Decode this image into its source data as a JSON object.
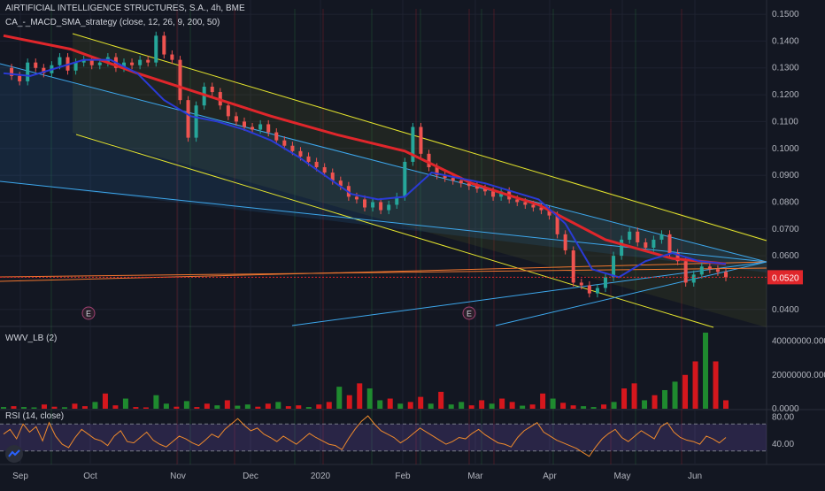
{
  "header": {
    "title": "AIRTIFICIAL INTELLIGENCE STRUCTURES, S.A., 4h, BME",
    "strategy": "CA_-_MACD_SMA_strategy (close, 12, 26, 9, 200, 50)",
    "volume_indicator": "WWV_LB (2)",
    "rsi_indicator": "RSI (14, close)"
  },
  "colors": {
    "background": "#131722",
    "sma200": "#e0262b",
    "sma50_up": "#2a3bd6",
    "sma50_down": "#d6413d",
    "trend_lines": "#e5e52d",
    "fan_lines": "#3da7ec",
    "horizontal_line": "#f0762f",
    "volume_up": "#1f8a2f",
    "volume_down": "#d5171d",
    "rsi_line": "#ef8a2c",
    "rsi_band": "#7b5dc7",
    "price_label": "#e0262b"
  },
  "chart_data": [
    {
      "type": "line",
      "panel": "price",
      "price_axis_ticks": [
        "0.1500",
        "0.1400",
        "0.1300",
        "0.1200",
        "0.1100",
        "0.1000",
        "0.0900",
        "0.0800",
        "0.0700",
        "0.0600",
        "0.0400"
      ],
      "time_axis_ticks": [
        "Sep",
        "Oct",
        "Nov",
        "Dec",
        "2020",
        "Feb",
        "Mar",
        "Apr",
        "May",
        "Jun"
      ],
      "ylim": [
        0.034,
        0.152
      ],
      "current_price": "0.0520",
      "earnings_markers": [
        "E",
        "E"
      ],
      "series": [
        {
          "name": "close",
          "x": [
            0,
            6,
            12,
            18,
            24,
            30,
            36,
            42,
            48,
            54,
            60,
            66,
            72,
            78,
            84,
            90,
            96,
            102,
            108,
            114,
            120,
            126,
            132,
            138,
            144,
            150,
            156,
            162,
            168,
            174,
            180,
            186,
            192,
            198,
            204,
            210,
            216,
            222,
            228,
            234,
            240,
            246,
            252,
            258,
            264,
            270,
            276,
            282,
            288,
            294,
            300,
            306,
            312,
            318,
            324,
            330,
            336,
            342,
            348,
            354,
            360,
            366,
            372,
            378,
            384,
            390,
            396,
            402,
            408,
            414,
            420,
            426,
            432,
            438,
            444,
            450,
            456,
            462,
            468,
            474,
            480,
            486,
            492,
            498,
            504,
            510,
            516,
            522,
            528,
            534,
            540
          ],
          "values": [
            0.13,
            0.127,
            0.125,
            0.132,
            0.13,
            0.128,
            0.131,
            0.134,
            0.129,
            0.132,
            0.133,
            0.131,
            0.132,
            0.134,
            0.13,
            0.132,
            0.131,
            0.133,
            0.132,
            0.142,
            0.135,
            0.133,
            0.118,
            0.104,
            0.116,
            0.123,
            0.121,
            0.116,
            0.112,
            0.11,
            0.108,
            0.107,
            0.109,
            0.106,
            0.103,
            0.101,
            0.099,
            0.097,
            0.095,
            0.093,
            0.091,
            0.088,
            0.086,
            0.082,
            0.081,
            0.078,
            0.08,
            0.077,
            0.079,
            0.082,
            0.095,
            0.108,
            0.098,
            0.093,
            0.09,
            0.089,
            0.088,
            0.087,
            0.086,
            0.085,
            0.084,
            0.082,
            0.084,
            0.081,
            0.08,
            0.079,
            0.078,
            0.077,
            0.075,
            0.068,
            0.062,
            0.05,
            0.049,
            0.046,
            0.048,
            0.052,
            0.06,
            0.066,
            0.069,
            0.065,
            0.063,
            0.066,
            0.068,
            0.061,
            0.058,
            0.05,
            0.053,
            0.056,
            0.055,
            0.054,
            0.052
          ]
        },
        {
          "name": "SMA 200",
          "x": [
            0,
            50,
            100,
            150,
            200,
            250,
            300,
            350,
            400,
            450,
            500,
            540
          ],
          "values": [
            0.142,
            0.137,
            0.128,
            0.12,
            0.112,
            0.105,
            0.099,
            0.087,
            0.079,
            0.066,
            0.059,
            0.057
          ]
        },
        {
          "name": "SMA 50",
          "x": [
            0,
            20,
            40,
            60,
            80,
            100,
            120,
            140,
            160,
            180,
            200,
            220,
            240,
            260,
            280,
            300,
            320,
            340,
            360,
            380,
            400,
            420,
            440,
            460,
            480,
            500,
            520,
            540
          ],
          "values": [
            0.128,
            0.127,
            0.13,
            0.133,
            0.133,
            0.128,
            0.118,
            0.112,
            0.11,
            0.107,
            0.103,
            0.097,
            0.09,
            0.083,
            0.081,
            0.082,
            0.091,
            0.089,
            0.087,
            0.084,
            0.081,
            0.072,
            0.055,
            0.052,
            0.058,
            0.061,
            0.058,
            0.057
          ]
        }
      ]
    },
    {
      "type": "bar",
      "panel": "volume",
      "axis_ticks": [
        "40000000.0000",
        "20000000.0000",
        "0.0000"
      ],
      "ylim": [
        0,
        45000000
      ],
      "values": [
        1000000,
        1500000,
        1000000,
        800000,
        2500000,
        1200000,
        900000,
        3000000,
        1500000,
        4000000,
        9000000,
        2000000,
        6000000,
        1000000,
        800000,
        8000000,
        3000000,
        1200000,
        4500000,
        1000000,
        3000000,
        2000000,
        5000000,
        1800000,
        2500000,
        1200000,
        3000000,
        4000000,
        1500000,
        2000000,
        1000000,
        2500000,
        4000000,
        13000000,
        8000000,
        15000000,
        12000000,
        5000000,
        6000000,
        3000000,
        4000000,
        7000000,
        3000000,
        10000000,
        2500000,
        4000000,
        2000000,
        5000000,
        3000000,
        6000000,
        4000000,
        1800000,
        2500000,
        9000000,
        6000000,
        3500000,
        2000000,
        1500000,
        1000000,
        2500000,
        4000000,
        12000000,
        15000000,
        5000000,
        8000000,
        11000000,
        16000000,
        20000000,
        28000000,
        45000000,
        28000000,
        5000000
      ]
    },
    {
      "type": "line",
      "panel": "rsi",
      "axis_ticks": [
        "80.00",
        "40.00"
      ],
      "ylim": [
        10,
        90
      ],
      "band": [
        30,
        70
      ],
      "values": [
        55,
        62,
        48,
        70,
        58,
        66,
        45,
        72,
        52,
        40,
        35,
        50,
        62,
        55,
        48,
        45,
        38,
        52,
        60,
        44,
        42,
        50,
        58,
        46,
        40,
        36,
        44,
        52,
        48,
        42,
        38,
        46,
        55,
        50,
        62,
        70,
        78,
        68,
        60,
        64,
        55,
        50,
        44,
        52,
        46,
        40,
        48,
        56,
        50,
        45,
        40,
        38,
        32,
        48,
        62,
        74,
        82,
        70,
        60,
        55,
        50,
        42,
        48,
        56,
        64,
        58,
        52,
        46,
        40,
        44,
        50,
        48,
        56,
        62,
        54,
        48,
        42,
        40,
        36,
        50,
        60,
        66,
        72,
        58,
        52,
        46,
        42,
        38,
        34,
        28,
        22,
        36,
        48,
        56,
        62,
        50,
        44,
        52,
        60,
        54,
        48,
        66,
        72,
        58,
        50,
        46,
        44,
        40,
        52,
        48,
        42,
        50
      ]
    }
  ]
}
